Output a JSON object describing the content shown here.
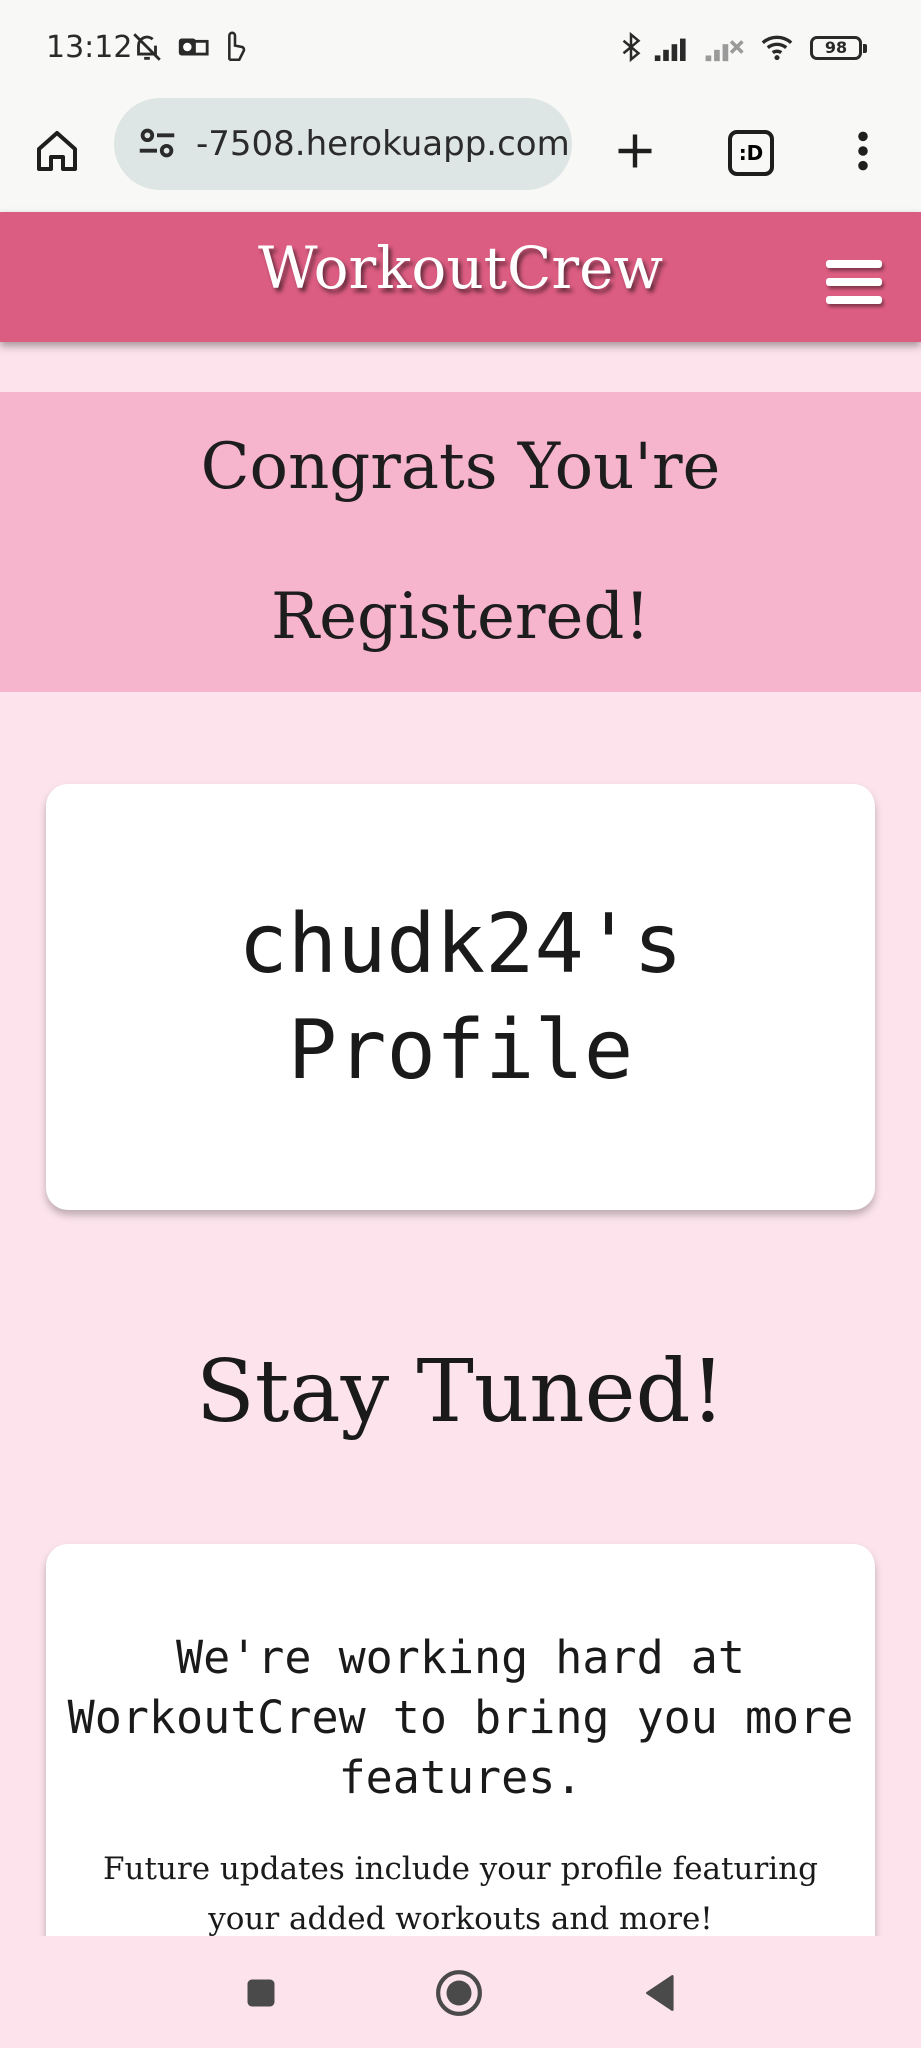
{
  "status_bar": {
    "time": "13:12",
    "battery": "98",
    "icons": [
      "bell-off-icon",
      "outlook-icon",
      "hand-icon",
      "bluetooth-icon",
      "signal-icon",
      "signal-off-icon",
      "wifi-icon"
    ]
  },
  "browser": {
    "url": "-7508.herokuapp.com",
    "tab_count_glyph": ":D",
    "icons": [
      "home-icon",
      "site-settings-icon",
      "new-tab-icon",
      "tab-switcher-icon",
      "more-menu-icon"
    ]
  },
  "site": {
    "brand": "WorkoutCrew",
    "header_color": "#dc5d82",
    "menu_icon": "hamburger-menu-icon"
  },
  "congrats": {
    "line1": "Congrats You're",
    "line2": "Registered!",
    "background": "#f6b5cc"
  },
  "profile": {
    "title_line1": "chudk24's",
    "title_line2": "Profile"
  },
  "stay_tuned": "Stay Tuned!",
  "updates": {
    "heading": "We're working hard at WorkoutCrew to bring you more features.",
    "body": "Future updates include your profile featuring your added workouts and more!"
  },
  "nav_bar": {
    "icons": [
      "recents-icon",
      "home-icon",
      "back-icon"
    ]
  },
  "colors": {
    "page_bg": "#fde3ec",
    "card_bg": "#ffffff"
  }
}
